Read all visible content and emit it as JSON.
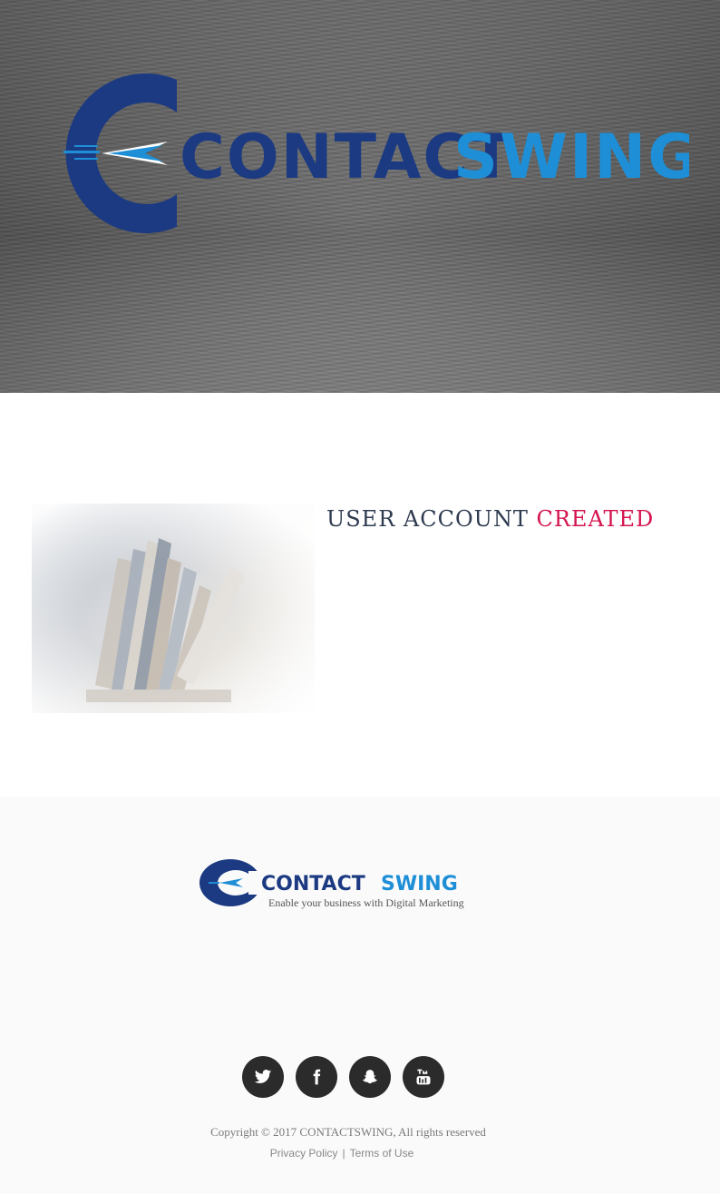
{
  "hero": {
    "logo": {
      "word1": "CONTACT",
      "word2": "SWING",
      "colors": {
        "dark": "#1b3a82",
        "light": "#1e8fd6"
      }
    }
  },
  "main": {
    "heading": {
      "part1": "USER ACCOUNT",
      "part2": "CREATED"
    },
    "colors": {
      "heading_dark": "#2e3b50",
      "heading_accent": "#d4144f"
    }
  },
  "footer": {
    "logo": {
      "word1": "CONTACT",
      "word2": "SWING",
      "tagline": "Enable your business with Digital Marketing"
    },
    "social": [
      {
        "name": "twitter",
        "icon": "twitter-icon"
      },
      {
        "name": "facebook",
        "icon": "facebook-icon"
      },
      {
        "name": "snapchat",
        "icon": "snapchat-icon"
      },
      {
        "name": "youtube",
        "icon": "youtube-icon"
      }
    ],
    "copyright": "Copyright © 2017 CONTACTSWING, All rights reserved",
    "links": {
      "privacy": "Privacy Policy",
      "separator": "|",
      "terms": "Terms of Use"
    }
  }
}
